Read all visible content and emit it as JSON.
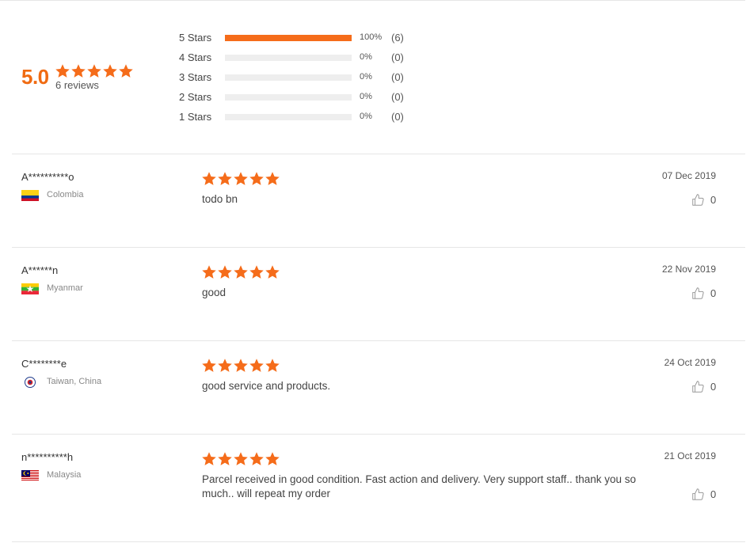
{
  "summary": {
    "average": "5.0",
    "rating_stars": 5,
    "review_count": "6 reviews",
    "distribution": [
      {
        "label": "5  Stars",
        "percent": "100%",
        "count": "(6)",
        "fill": 1.0
      },
      {
        "label": "4  Stars",
        "percent": "0%",
        "count": "(0)",
        "fill": 0
      },
      {
        "label": "3  Stars",
        "percent": "0%",
        "count": "(0)",
        "fill": 0
      },
      {
        "label": "2  Stars",
        "percent": "0%",
        "count": "(0)",
        "fill": 0
      },
      {
        "label": "1  Stars",
        "percent": "0%",
        "count": "(0)",
        "fill": 0
      }
    ]
  },
  "colors": {
    "accent": "#f56c1a",
    "track": "#eeeeee",
    "divider": "#e6e6e6"
  },
  "reviews": [
    {
      "name": "A**********o",
      "country": "Colombia",
      "flag_icon": "colombia-flag-icon",
      "stars": 5,
      "text": "todo bn",
      "date": "07 Dec 2019",
      "likes": "0"
    },
    {
      "name": "A******n",
      "country": "Myanmar",
      "flag_icon": "myanmar-flag-icon",
      "stars": 5,
      "text": "good",
      "date": "22 Nov 2019",
      "likes": "0"
    },
    {
      "name": "C********e",
      "country": "Taiwan, China",
      "flag_icon": "taiwan-flag-icon",
      "stars": 5,
      "text": "good service and products.",
      "date": "24 Oct 2019",
      "likes": "0"
    },
    {
      "name": "n**********h",
      "country": "Malaysia",
      "flag_icon": "malaysia-flag-icon",
      "stars": 5,
      "text": "Parcel received in good condition. Fast action and delivery. Very support staff.. thank you so much.. will repeat my order",
      "date": "21 Oct 2019",
      "likes": "0"
    }
  ]
}
